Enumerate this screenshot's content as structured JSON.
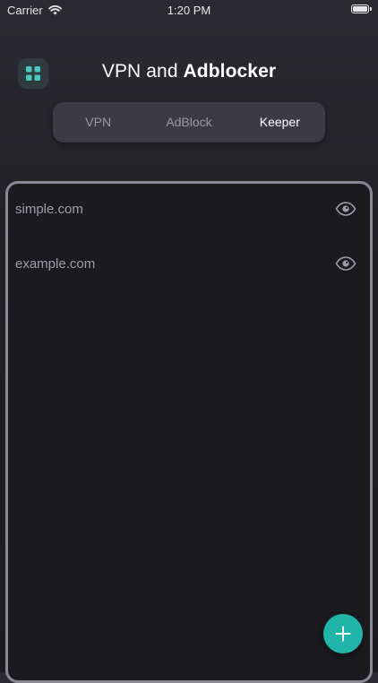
{
  "status_bar": {
    "carrier": "Carrier",
    "time": "1:20 PM"
  },
  "header": {
    "title_regular": "VPN and",
    "title_bold": "Adblocker"
  },
  "tabs": [
    {
      "label": "VPN",
      "active": false
    },
    {
      "label": "AdBlock",
      "active": false
    },
    {
      "label": "Keeper",
      "active": true
    }
  ],
  "list": {
    "items": [
      {
        "label": "simple.com"
      },
      {
        "label": "example.com"
      }
    ]
  },
  "colors": {
    "accent": "#1fb5a9",
    "menu_icon": "#47c9c0",
    "panel_border": "#8b8896"
  },
  "icons": {
    "menu": "grid-icon",
    "visibility": "eye-icon",
    "add": "plus-icon",
    "wifi": "wifi-icon",
    "battery": "battery-icon"
  }
}
